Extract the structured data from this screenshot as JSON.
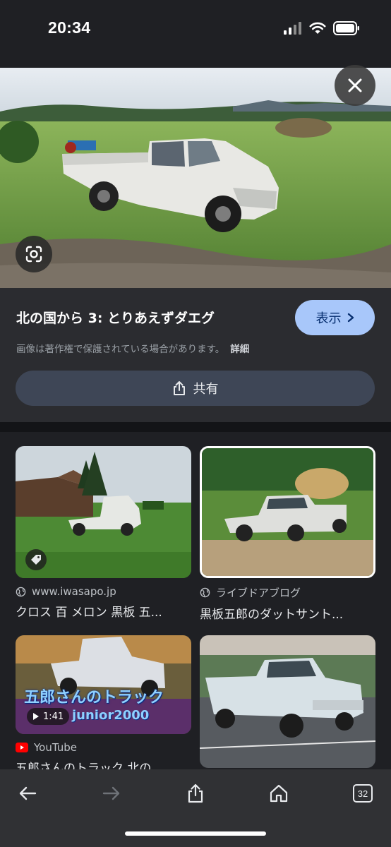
{
  "status_bar": {
    "time": "20:34"
  },
  "viewer": {
    "title": "北の国から 3: とりあえずダエグ",
    "visit_label": "表示",
    "copyright_notice": "画像は著作権で保護されている場合があります。",
    "details_label": "詳細",
    "share_label": "共有"
  },
  "results": [
    {
      "source": "www.iwasapo.jp",
      "caption": "クロス 百 メロン 黒板 五..."
    },
    {
      "source": "ライブドアブログ",
      "caption": "黒板五郎のダットサント..."
    },
    {
      "source": "YouTube",
      "caption": "五郎さんのトラック 北の",
      "duration": "1:41",
      "overlay_title": "五郎さんのトラック",
      "overlay_sub": "junior2000"
    },
    {
      "source": "",
      "caption": ""
    }
  ],
  "toolbar": {
    "tabs_count": "32"
  },
  "colors": {
    "accent": "#a8c7fa",
    "share_bg": "#3e4656",
    "youtube_red": "#ff0000"
  }
}
